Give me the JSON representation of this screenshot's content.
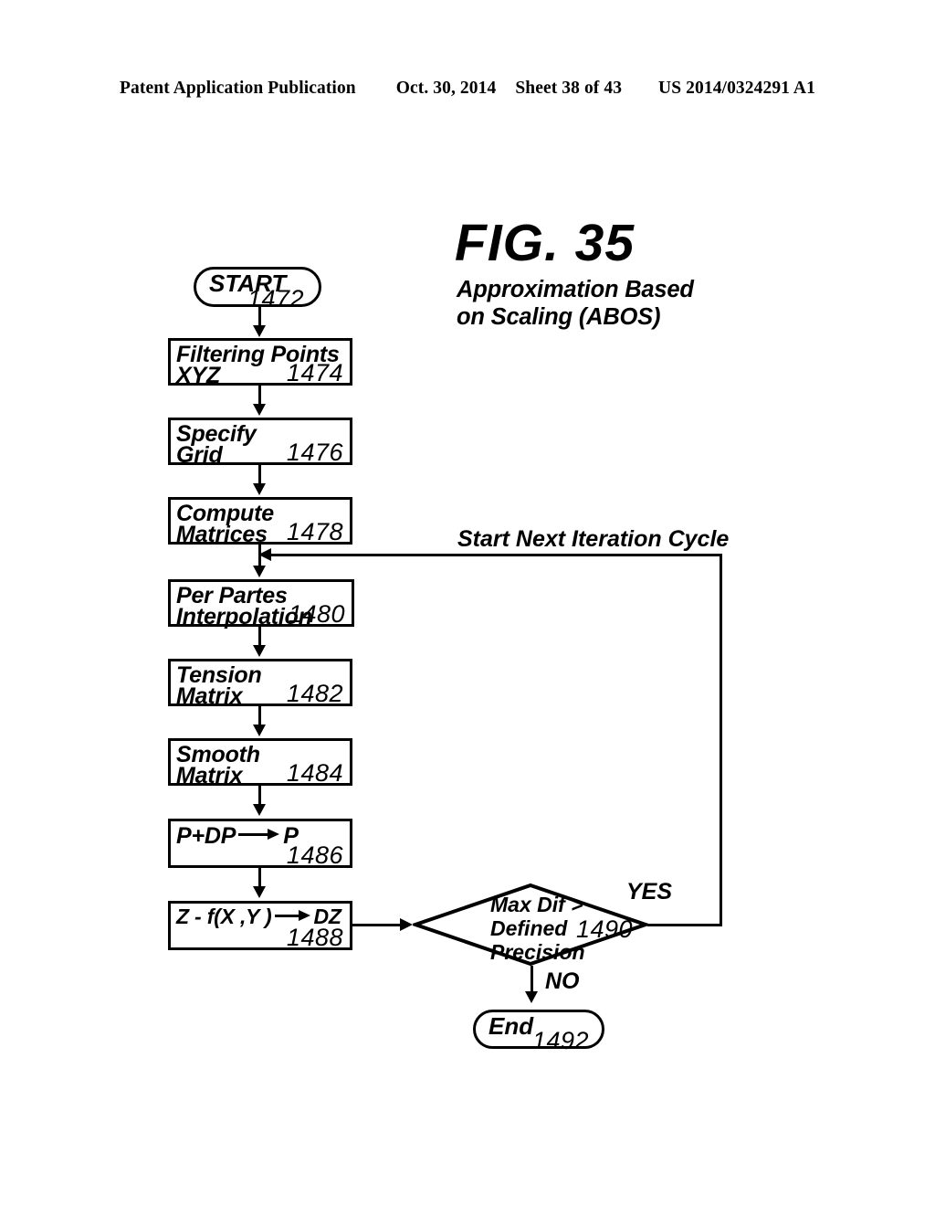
{
  "header": {
    "publication": "Patent Application Publication",
    "date": "Oct. 30, 2014",
    "sheet": "Sheet 38 of 43",
    "patent_number": "US 2014/0324291 A1"
  },
  "figure": {
    "title": "FIG. 35",
    "subtitle_line1": "Approximation Based",
    "subtitle_line2": "on Scaling (ABOS)"
  },
  "flowchart": {
    "start": {
      "label": "START",
      "ref": "1472"
    },
    "end": {
      "label": "End",
      "ref": "1492"
    },
    "steps": [
      {
        "line1": "Filtering Points",
        "line2": "XYZ",
        "ref": "1474"
      },
      {
        "line1": "Specify",
        "line2": "Grid",
        "ref": "1476"
      },
      {
        "line1": "Compute",
        "line2": "Matrices",
        "ref": "1478"
      },
      {
        "line1": "Per Partes",
        "line2": "Interpolation",
        "ref": "1480"
      },
      {
        "line1": "Tension",
        "line2": "Matrix",
        "ref": "1482"
      },
      {
        "line1": "Smooth",
        "line2": "Matrix",
        "ref": "1484"
      },
      {
        "line1_pre": "P+DP",
        "line1_post": "P",
        "line2": "",
        "ref": "1486"
      },
      {
        "line1_pre": "Z  - f(X ,Y )",
        "line1_post": "DZ",
        "line2": "",
        "ref": "1488"
      }
    ],
    "decision": {
      "line1": "Max Dif >",
      "line2": "Defined",
      "line3": "Precision",
      "ref": "1490",
      "yes_label": "YES",
      "no_label": "NO"
    },
    "loop_label": "Start Next Iteration Cycle"
  },
  "colors": {
    "ink": "#000000",
    "paper": "#ffffff"
  }
}
